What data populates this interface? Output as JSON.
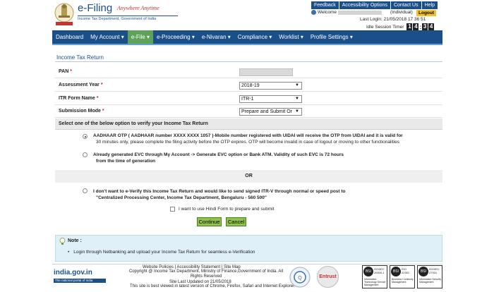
{
  "header": {
    "brand_title": "e-Filing",
    "brand_tagline": "Anywhere Anytime",
    "brand_sub": "Income Tax Department, Government of India",
    "top_links": [
      "Feedback",
      "Accessibility Options",
      "Contact Us",
      "Help"
    ],
    "welcome_label": "Welcome",
    "user_type": "(Individual)",
    "logout_label": "Logout",
    "last_login": "Last Login: 21/05/2018 17 36 51",
    "idle_label": "Idle Session Timer",
    "idle_digits": [
      "1",
      "4",
      "3",
      "4"
    ]
  },
  "nav": {
    "items": [
      "Dashboard",
      "My Account",
      "e-File",
      "e-Proceeding",
      "e-Nivaran",
      "Compliance",
      "Worklist",
      "Profile Settings"
    ],
    "active": "e-File",
    "colors": {
      "bar": "#1a4f8a",
      "active": "#5fa35a"
    }
  },
  "form": {
    "title": "Income Tax Return",
    "fields": [
      {
        "label": "PAN",
        "value": ""
      },
      {
        "label": "Assessment Year",
        "value": "2018-19"
      },
      {
        "label": "ITR Form Name",
        "value": "ITR-1"
      },
      {
        "label": "Submission Mode",
        "value": "Prepare and Submit Or"
      }
    ],
    "verify_heading": "Select one of the below option to verify your Income Tax Return",
    "options": [
      {
        "checked": true,
        "line1": "AADHAAR OTP ( AADHAAR number XXXX XXXX 1057 )-Mobile number registered with UIDAI will receive the OTP from UIDAI and it is valid for",
        "line2": "30 minutes only, please complete the filing activity before the OTP expires. OTP will become invalid in case of logout or moving to other functionalities"
      },
      {
        "checked": false,
        "line1": "Already generated EVC through My Account -> Generate EVC option or Bank ATM. Validity of such EVC is 72 hours",
        "line2": "from the time of generation"
      },
      {
        "checked": false,
        "line1": "I don't want to e-Verify this Income Tax Return and would like to send signed ITR-V through normal or speed post to",
        "line2": "\"Centralized Processing Center, Income Tax Department, Bengaluru - 560 500\""
      }
    ],
    "or_label": "OR",
    "hindi_checkbox_label": "I want to use Hindi Form to prepare and submit",
    "continue_label": "Continue",
    "cancel_label": "Cancel"
  },
  "note": {
    "title": "Note :",
    "items": [
      "Login through Netbanking and upload your Income Tax Return for seamless e-Verification"
    ]
  },
  "footer": {
    "links": "Website Policies  |  Accessibility Statement  |  Site Map",
    "copyright": "Copyright @ Income Tax Department, Ministry of Finance,Government of India. All Rights Reserved",
    "updated": "Site Last Updated on 21/05/2018",
    "browser": "This site is best viewed in latest version of Chrome, Firefox, Safari and Internet Explorer.",
    "india_gov": "india.gov.in",
    "india_gov_sub": "The national portal of India",
    "entrust": "Entrust",
    "iso_badges": [
      {
        "code": "BSI",
        "std": "ISO/IEC 20000-1",
        "desc": "Information Technology Service Management"
      },
      {
        "code": "BSI",
        "std": "ISO 22301",
        "desc": "Business Continuity Management"
      },
      {
        "code": "BSI",
        "std": "ISO/IEC 27001",
        "desc": "Information Security Management"
      }
    ]
  }
}
